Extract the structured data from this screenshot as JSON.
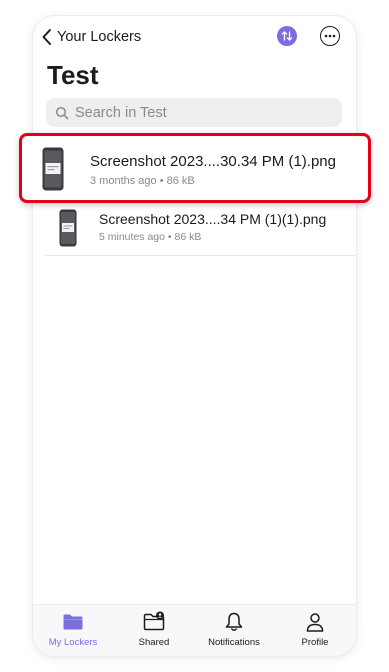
{
  "nav": {
    "back_label": "Your Lockers"
  },
  "page": {
    "title": "Test"
  },
  "search": {
    "placeholder": "Search in Test"
  },
  "files": [
    {
      "name": "Screenshot 2023....30.34 PM (1).png",
      "age": "3 months ago",
      "size": "86 kB",
      "highlighted": true
    },
    {
      "name": "Screenshot 2023....34 PM (1)(1).png",
      "age": "5 minutes ago",
      "size": "86 kB",
      "highlighted": false
    }
  ],
  "tabs": [
    {
      "label": "My Lockers",
      "icon": "folder-icon",
      "active": true
    },
    {
      "label": "Shared",
      "icon": "shared-folder-icon",
      "active": false
    },
    {
      "label": "Notifications",
      "icon": "bell-icon",
      "active": false
    },
    {
      "label": "Profile",
      "icon": "person-icon",
      "active": false
    }
  ],
  "colors": {
    "accent": "#7b6fe0",
    "highlight_border": "#e3001b",
    "secondary_text": "#8a8a8e"
  }
}
